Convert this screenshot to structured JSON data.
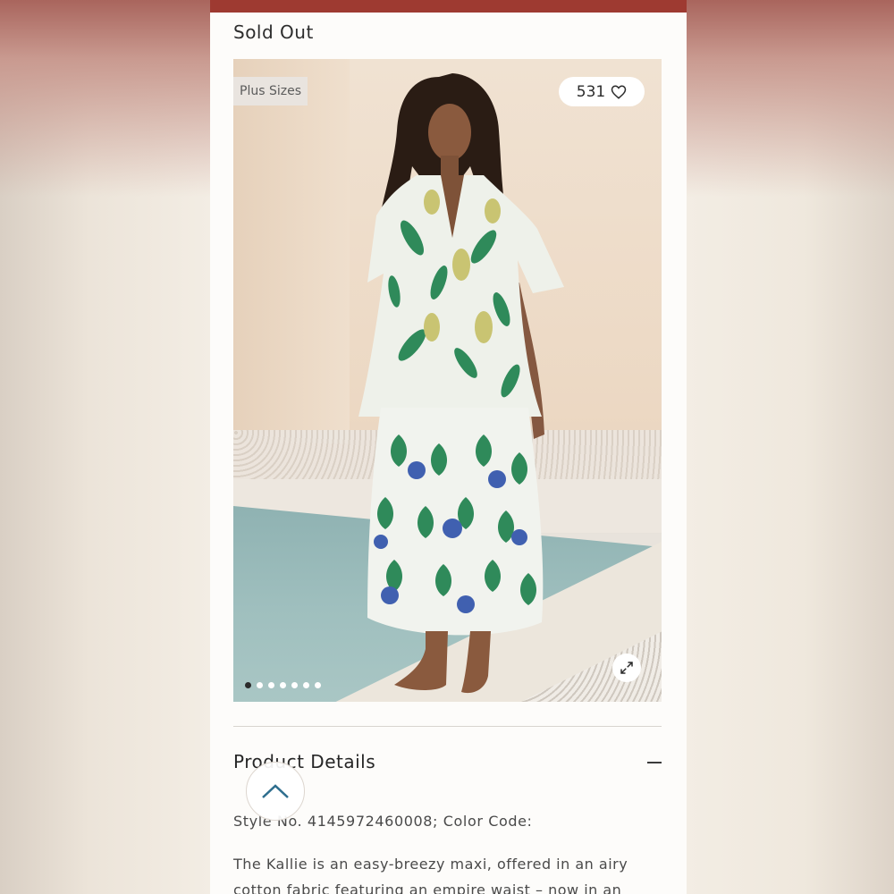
{
  "status": "Sold Out",
  "badge": "Plus Sizes",
  "likes": {
    "count": "531",
    "icon": "heart-icon"
  },
  "carousel": {
    "total": 7,
    "active": 1
  },
  "details": {
    "title": "Product Details",
    "style_line": "Style No. 4145972460008; Color Code:",
    "description": "The Kallie is an easy-breezy maxi, offered in an airy cotton fabric featuring an empire waist – now in an"
  },
  "colors": {
    "topbar": "#9e3a31",
    "dress_green": "#2f8a5a",
    "dress_blue": "#4060b0",
    "dress_yellow": "#c9c472"
  },
  "icons": [
    "heart-icon",
    "expand-icon",
    "minus-icon",
    "chevron-up-icon"
  ]
}
